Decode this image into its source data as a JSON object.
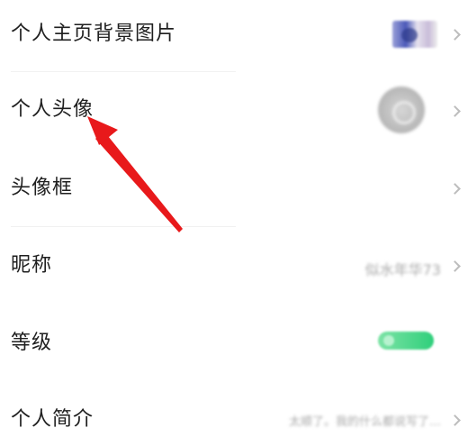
{
  "settings": {
    "rows": [
      {
        "label": "个人主页背景图片"
      },
      {
        "label": "个人头像"
      },
      {
        "label": "头像框"
      },
      {
        "label": "昵称",
        "value": "似水年华73"
      },
      {
        "label": "等级"
      },
      {
        "label": "个人简介",
        "value": "太顺了。我的什么都说写了…"
      }
    ]
  },
  "colors": {
    "arrow": "#e8191b",
    "level_badge": "#3ccf7f",
    "chevron": "#bdbdbd"
  },
  "icons": {
    "chevron": "chevron-right-icon",
    "annotation": "red-arrow-annotation"
  }
}
